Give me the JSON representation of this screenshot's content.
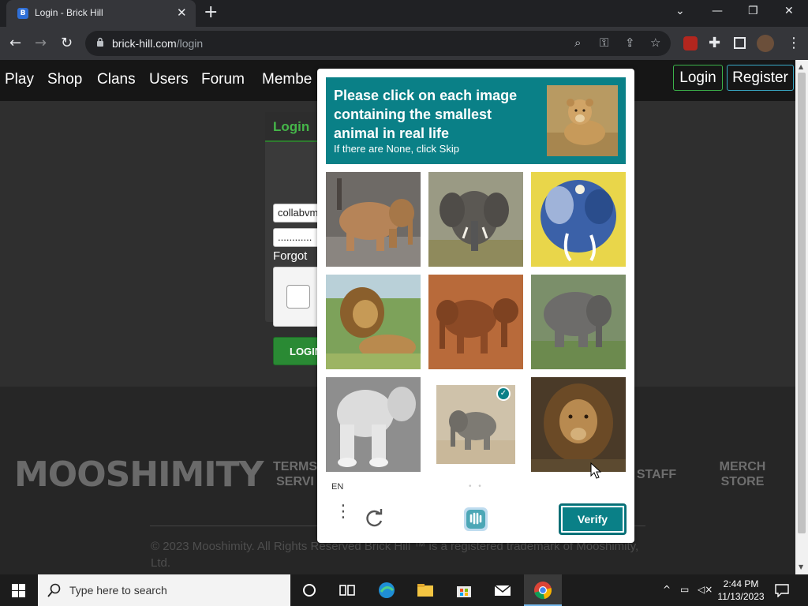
{
  "browser": {
    "tab_title": "Login - Brick Hill",
    "tab_favicon": "B",
    "url_domain": "brick-hill.com",
    "url_path": "/login"
  },
  "nav": {
    "links": [
      "Play",
      "Shop",
      "Clans",
      "Users",
      "Forum",
      "Membe"
    ],
    "login": "Login",
    "register": "Register"
  },
  "login_form": {
    "title": "Login",
    "username_value": "collabvm",
    "password_value": "............",
    "forgot": "Forgot",
    "submit": "LOGIN"
  },
  "footer": {
    "logo": "MOOSHIMITY",
    "links": [
      "TERMS\nSERVI",
      "STAFF",
      "MERCH\nSTORE"
    ],
    "copyright": "© 2023 Mooshimity. All Rights Reserved Brick Hill ™ is a registered trademark of Mooshimity, Ltd."
  },
  "captcha": {
    "prompt": "Please click on each image containing the smallest animal in real life",
    "sub": "If there are None, click Skip",
    "sample_icon": "lioness-photo",
    "tiles": [
      {
        "name": "elephant-tile",
        "selected": false
      },
      {
        "name": "elephant-tile",
        "selected": false
      },
      {
        "name": "elephant-painting-tile",
        "selected": false
      },
      {
        "name": "lion-tile",
        "selected": false
      },
      {
        "name": "elephant-tile",
        "selected": false
      },
      {
        "name": "elephant-tile",
        "selected": false
      },
      {
        "name": "elephant-statue-tile",
        "selected": false
      },
      {
        "name": "baby-elephant-tile",
        "selected": true
      },
      {
        "name": "lion-tile",
        "selected": false
      }
    ],
    "language": "EN",
    "verify": "Verify"
  },
  "taskbar": {
    "search_placeholder": "Type here to search",
    "time": "2:44 PM",
    "date": "11/13/2023"
  },
  "colors": {
    "hcaptcha_teal": "#0a8087",
    "login_green": "#45b649",
    "chrome_dark": "#202124"
  }
}
